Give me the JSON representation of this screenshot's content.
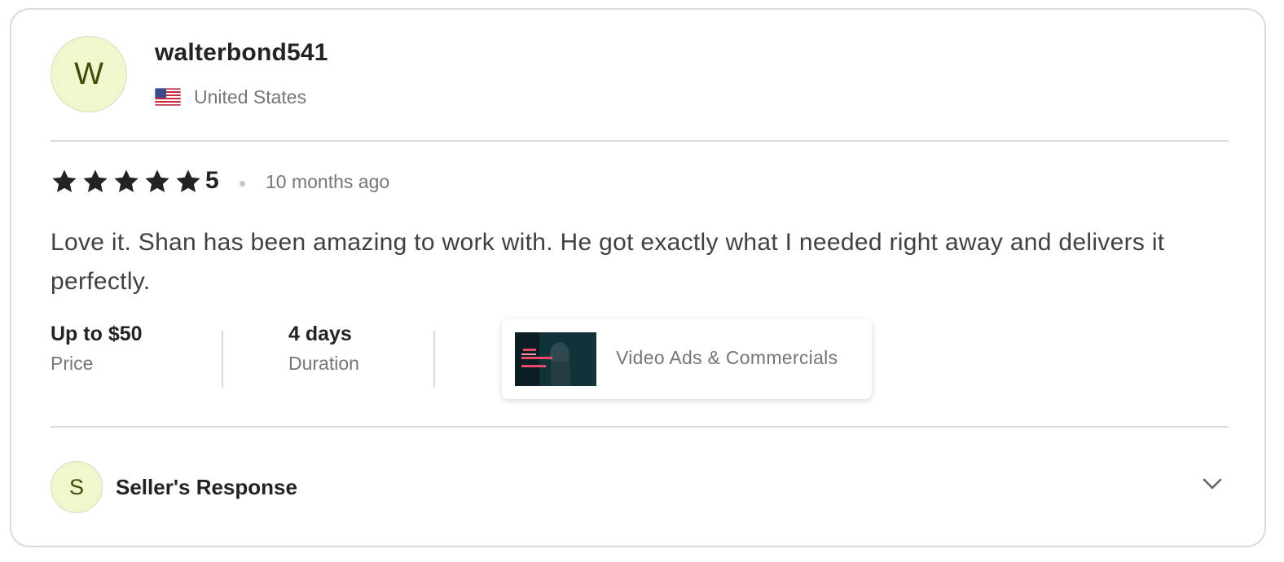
{
  "reviewer": {
    "avatar_letter": "W",
    "username": "walterbond541",
    "country": "United States",
    "flag_icon": "us-flag-icon"
  },
  "rating": {
    "stars": 5,
    "value": "5",
    "time_ago": "10 months ago"
  },
  "review": {
    "text": "Love it. Shan has been amazing to work with. He got exactly what I needed right away and delivers it perfectly."
  },
  "meta": {
    "price_value": "Up to $50",
    "price_label": "Price",
    "duration_value": "4 days",
    "duration_label": "Duration"
  },
  "category": {
    "label": "Video Ads & Commercials"
  },
  "seller_response": {
    "avatar_letter": "S",
    "title": "Seller's Response",
    "toggle_icon": "chevron-down-icon"
  },
  "colors": {
    "avatar_bg": "#f1f6cc",
    "avatar_text": "#3d4d05",
    "star": "#222325",
    "divider": "#dadbdd"
  }
}
